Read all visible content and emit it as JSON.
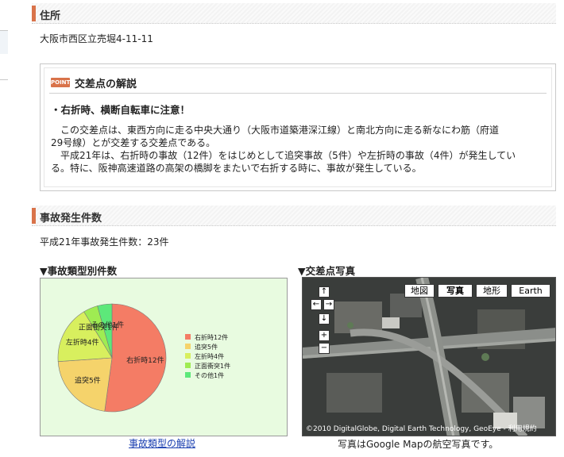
{
  "address": {
    "heading": "住所",
    "value": "大阪市西区立売堀4-11-11"
  },
  "point": {
    "badge": "POINT",
    "title": "交差点の解説",
    "warning": "・右折時、横断自転車に注意！",
    "p1_line1": "　この交差点は、東西方向に走る中央大通り（大阪市道築港深江線）と南北方向に走る新なにわ筋（府道",
    "p1_line2": "29号線）とが交差する交差点である。",
    "p2_line1": "　平成21年は、右折時の事故（12件）をはじめとして追突事故（5件）や左折時の事故（4件）が発生してい",
    "p2_line2": "る。特に、阪神高速道路の高架の橋脚をまたいで右折する時に、事故が発生している。"
  },
  "accidents": {
    "heading": "事故発生件数",
    "summary": "平成21年事故発生件数：23件"
  },
  "chart_section": {
    "title": "▼事故類型別件数",
    "link": "事故類型の解説"
  },
  "photo_section": {
    "title": "▼交差点写真",
    "caption": "写真はGoogle Mapの航空写真です。",
    "map_buttons": [
      "地図",
      "写真",
      "地形",
      "Earth"
    ],
    "active_button": "写真",
    "copyright": "©2010 DigitalGlobe, Digital Earth Technology, GeoEye - 利用規約"
  },
  "chart_data": {
    "type": "pie",
    "series": [
      {
        "name": "右折時12件",
        "value": 12,
        "color": "#f47c65"
      },
      {
        "name": "追突5件",
        "value": 5,
        "color": "#f5d36b"
      },
      {
        "name": "左折時4件",
        "value": 4,
        "color": "#d8ef5e"
      },
      {
        "name": "正面衝突1件",
        "value": 1,
        "color": "#9fec52"
      },
      {
        "name": "その他1件",
        "value": 1,
        "color": "#5de87a"
      }
    ],
    "legend_position": "right"
  }
}
